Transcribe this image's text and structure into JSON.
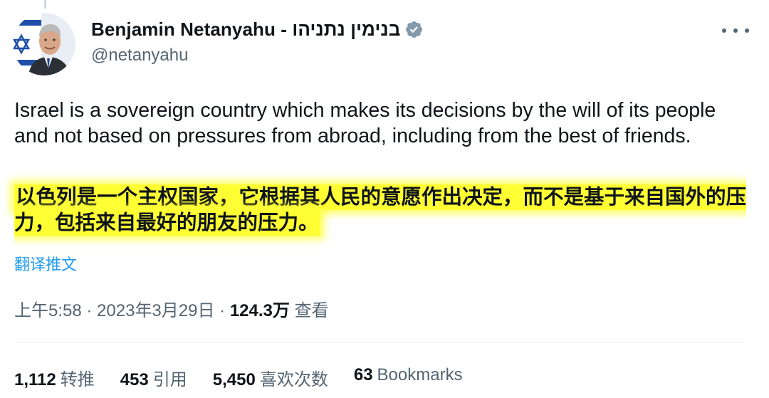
{
  "author": {
    "display_name": "Benjamin Netanyahu - בנימין נתניהו",
    "handle": "@netanyahu",
    "verified": true
  },
  "tweet": {
    "text": "Israel is a sovereign country which makes its decisions by the will of its people and not based on pressures from abroad, including from the best of friends.",
    "translated_text": "以色列是一个主权国家，它根据其人民的意愿作出决定，而不是基于来自国外的压力，包括来自最好的朋友的压力。",
    "translate_link": "翻译推文"
  },
  "meta": {
    "time": "上午5:58",
    "separator": " · ",
    "date": "2023年3月29日",
    "views_count": "124.3万",
    "views_label": "查看"
  },
  "stats": {
    "retweets_count": "1,112",
    "retweets_label": "转推",
    "quotes_count": "453",
    "quotes_label": "引用",
    "likes_count": "5,450",
    "likes_label": "喜欢次数",
    "bookmarks_count": "63",
    "bookmarks_label": "Bookmarks"
  },
  "icons": {
    "avatar": "profile-photo",
    "verified": "verified-badge-icon",
    "more": "more-options-icon"
  },
  "colors": {
    "text_primary": "#0f1419",
    "text_secondary": "#536471",
    "link": "#1d9bf0",
    "verified_badge": "#829aab",
    "highlight": "#ffff33"
  }
}
